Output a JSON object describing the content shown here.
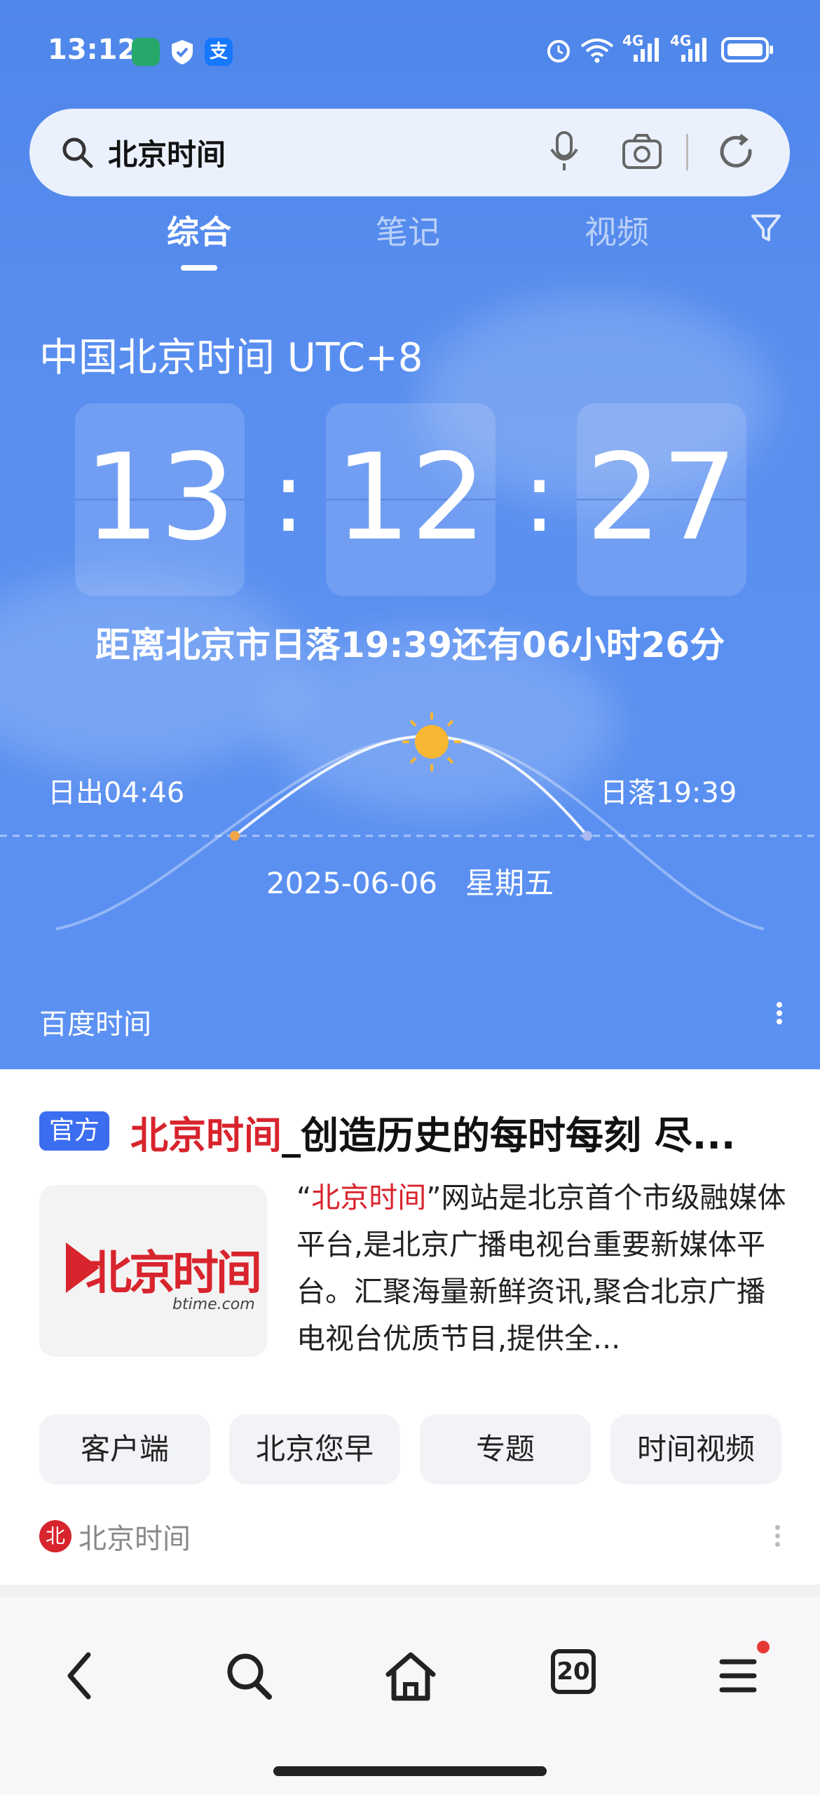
{
  "status_bar": {
    "time": "13:12",
    "network1": "4G",
    "network2": "4G"
  },
  "search": {
    "query": "北京时间"
  },
  "tabs": [
    "综合",
    "笔记",
    "视频"
  ],
  "clock": {
    "title": "中国北京时间 UTC+8",
    "hours": "13",
    "minutes": "12",
    "seconds": "27",
    "countdown": "距离北京市日落19:39还有06小时26分",
    "sunrise": "日出04:46",
    "sunset": "日落19:39",
    "date": "2025-06-06   星期五",
    "source": "百度时间"
  },
  "result": {
    "badge": "官方",
    "title_highlight": "北京时间",
    "title_rest": "_创造历史的每时每刻 尽...",
    "desc_quote_open": "“",
    "desc_highlight": "北京时间",
    "desc_rest": "”网站是北京首个市级融媒体平台,是北京广播电视台重要新媒体平台。汇聚海量新鲜资讯,聚合北京广播电视台优质节目,提供全...",
    "logo_text": "北京时间",
    "logo_sub": "btime.com",
    "chips": [
      "客户端",
      "北京您早",
      "专题",
      "时间视频"
    ],
    "source_name": "北京时间",
    "source_icon": "北"
  },
  "bottom_nav": {
    "tabs_count": "20"
  },
  "colors": {
    "hero_blue": "#5a8ff0",
    "badge_blue": "#3b6df0",
    "highlight_red": "#d8242d"
  }
}
